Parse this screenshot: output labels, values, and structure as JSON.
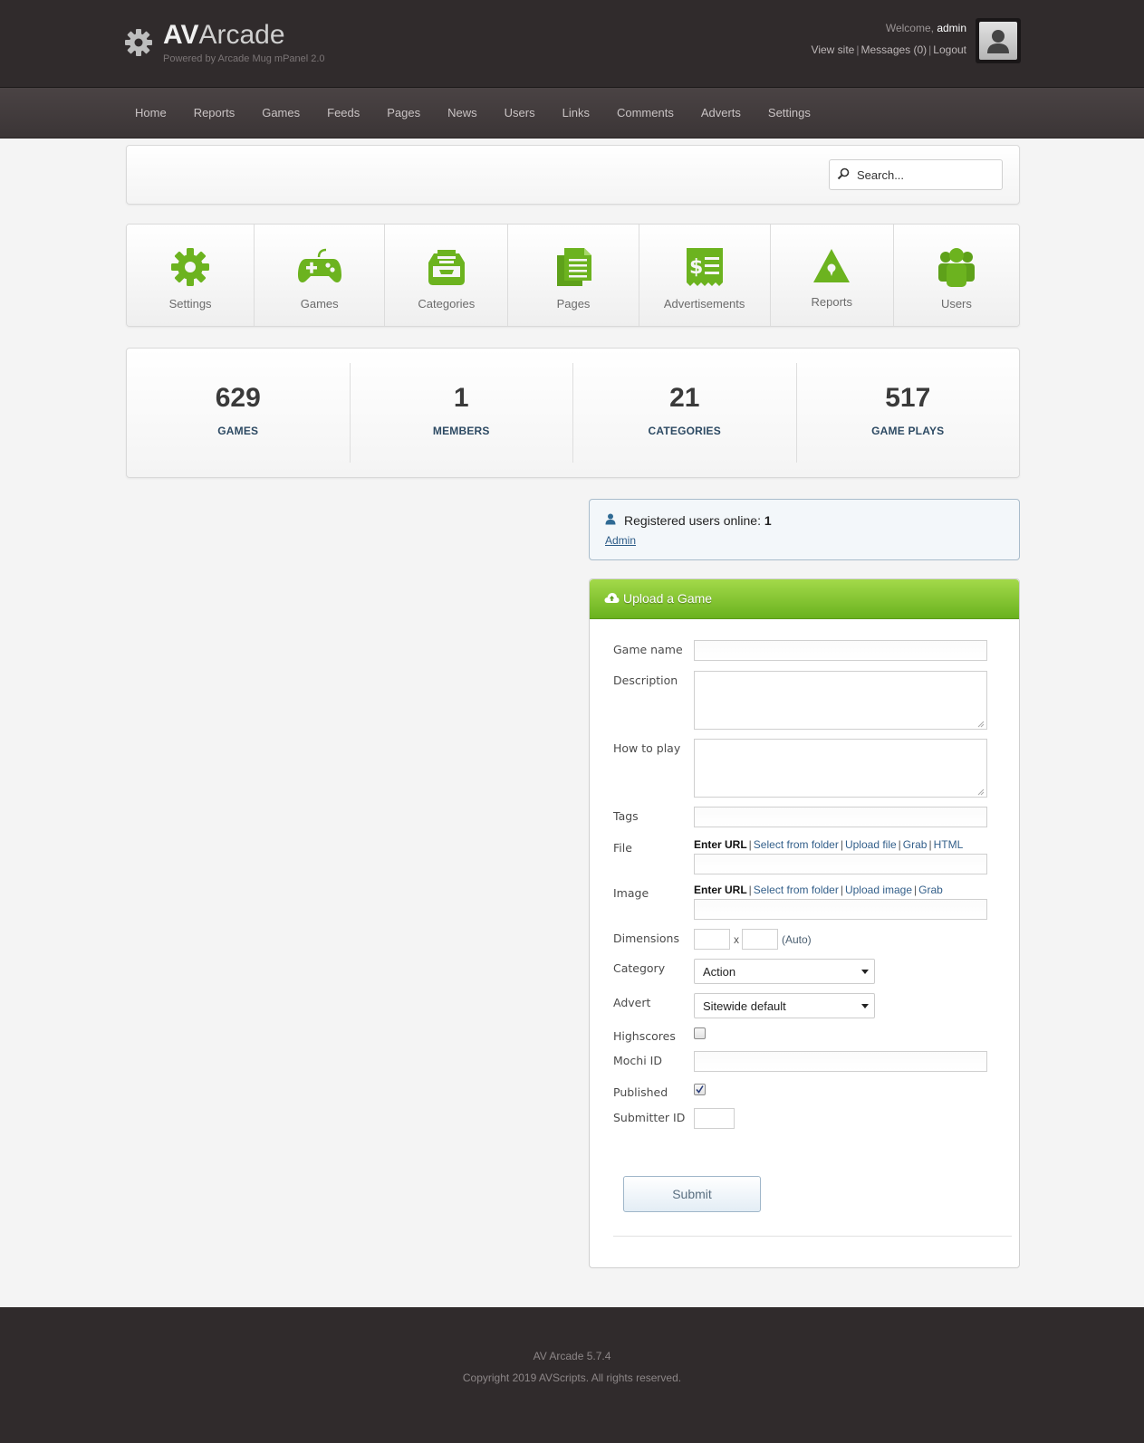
{
  "brand": {
    "title_bold": "AV",
    "title_light": "Arcade",
    "subtitle": "Powered by Arcade Mug mPanel 2.0"
  },
  "user": {
    "welcome_prefix": "Welcome,",
    "name": "admin",
    "links": [
      "View site",
      "Messages (0)",
      "Logout"
    ]
  },
  "nav": [
    "Home",
    "Reports",
    "Games",
    "Feeds",
    "Pages",
    "News",
    "Users",
    "Links",
    "Comments",
    "Adverts",
    "Settings"
  ],
  "search": {
    "placeholder": "Search..."
  },
  "quick_icons": [
    {
      "label": "Settings",
      "icon": "gear-icon"
    },
    {
      "label": "Games",
      "icon": "gamepad-icon"
    },
    {
      "label": "Categories",
      "icon": "inbox-tray-icon"
    },
    {
      "label": "Pages",
      "icon": "pages-icon"
    },
    {
      "label": "Advertisements",
      "icon": "dollar-receipt-icon"
    },
    {
      "label": "Reports",
      "icon": "warning-icon"
    },
    {
      "label": "Users",
      "icon": "users-group-icon"
    }
  ],
  "stats": [
    {
      "value": "629",
      "label": "GAMES"
    },
    {
      "value": "1",
      "label": "MEMBERS"
    },
    {
      "value": "21",
      "label": "CATEGORIES"
    },
    {
      "value": "517",
      "label": "GAME PLAYS"
    }
  ],
  "online": {
    "label": "Registered users online:",
    "count": "1",
    "user": "Admin"
  },
  "upload": {
    "title": "Upload a Game",
    "labels": {
      "game_name": "Game name",
      "description": "Description",
      "how_to_play": "How to play",
      "tags": "Tags",
      "file": "File",
      "image": "Image",
      "dimensions": "Dimensions",
      "category": "Category",
      "advert": "Advert",
      "highscores": "Highscores",
      "mochi_id": "Mochi ID",
      "published": "Published",
      "submitter_id": "Submitter ID"
    },
    "file_sources": {
      "active": "Enter URL",
      "options": [
        "Select from folder",
        "Upload file",
        "Grab",
        "HTML"
      ]
    },
    "image_sources": {
      "active": "Enter URL",
      "options": [
        "Select from folder",
        "Upload image",
        "Grab"
      ]
    },
    "dimensions_x": "x",
    "dimensions_auto": "(Auto)",
    "category_value": "Action",
    "advert_value": "Sitewide default",
    "highscores_checked": false,
    "published_checked": true,
    "submit_label": "Submit"
  },
  "footer": {
    "version": "AV Arcade 5.7.4",
    "copyright": "Copyright 2019 AVScripts. All rights reserved."
  },
  "colors": {
    "header_bg": "#302b2c",
    "accent_green": "#6ab21e",
    "link_blue": "#2b5a86",
    "stat_label": "#2d4a63"
  }
}
